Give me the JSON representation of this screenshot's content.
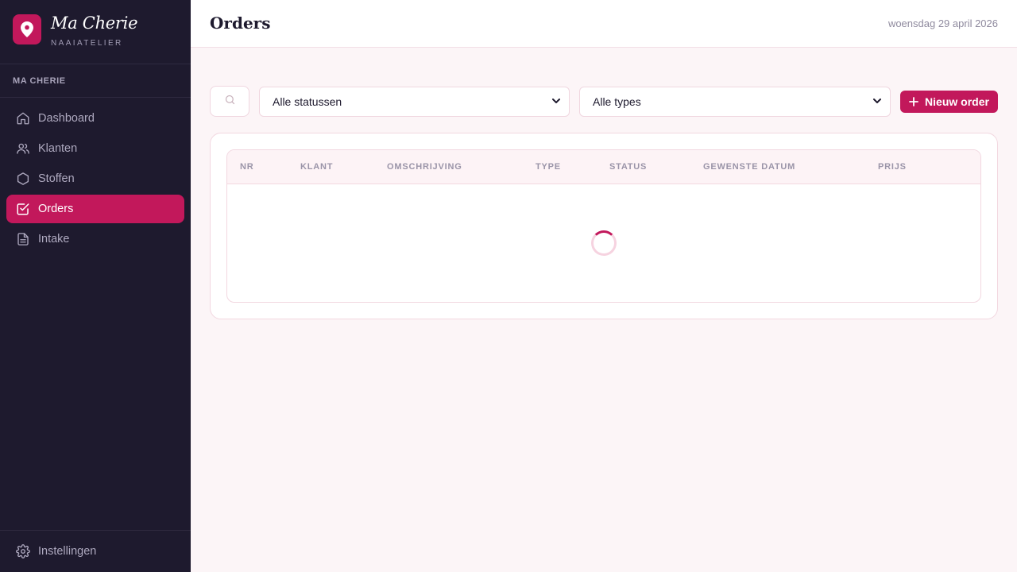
{
  "brand": {
    "name": "Ma Cherie",
    "subtitle": "NAAIATELIER"
  },
  "sidebar": {
    "section_label": "MA CHERIE",
    "items": [
      {
        "label": "Dashboard",
        "icon": "home-icon",
        "active": false
      },
      {
        "label": "Klanten",
        "icon": "users-icon",
        "active": false
      },
      {
        "label": "Stoffen",
        "icon": "hexagon-icon",
        "active": false
      },
      {
        "label": "Orders",
        "icon": "check-square-icon",
        "active": true
      },
      {
        "label": "Intake",
        "icon": "document-icon",
        "active": false
      }
    ],
    "footer": {
      "label": "Instellingen",
      "icon": "gear-icon"
    }
  },
  "header": {
    "title": "Orders",
    "date": "woensdag 29 april 2026"
  },
  "toolbar": {
    "status_filter": {
      "selected": "Alle statussen"
    },
    "type_filter": {
      "selected": "Alle types"
    },
    "new_button_label": "Nieuw order"
  },
  "table": {
    "columns": [
      "NR",
      "KLANT",
      "OMSCHRIJVING",
      "TYPE",
      "STATUS",
      "GEWENSTE DATUM",
      "PRIJS"
    ],
    "loading": true
  },
  "colors": {
    "accent": "#c2185b",
    "sidebar_bg": "#1e1a2e",
    "page_bg": "#fcf5f7"
  }
}
